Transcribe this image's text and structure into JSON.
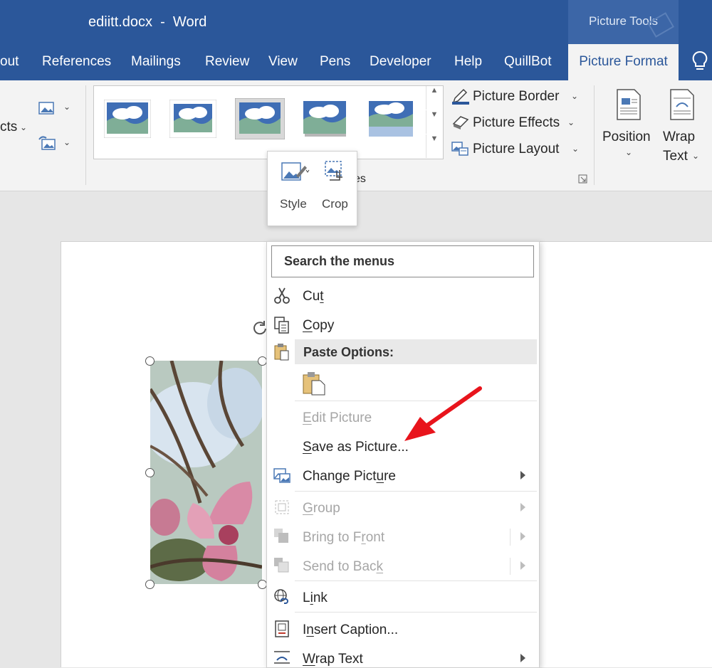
{
  "window": {
    "title": "ediitt.docx  -  Word",
    "context_group": "Picture Tools"
  },
  "tabs": [
    "out",
    "References",
    "Mailings",
    "Review",
    "View",
    "Pens",
    "Developer",
    "Help",
    "QuillBot"
  ],
  "active_tab": "Picture Format",
  "ribbon": {
    "left_partial_label": "cts",
    "picture_border": "Picture Border",
    "picture_effects": "Picture Effects",
    "picture_layout": "Picture Layout",
    "group_label_partial": "es",
    "position_label": "Position",
    "wrap_text_line1": "Wrap",
    "wrap_text_line2": "Text"
  },
  "mini_toolbar": {
    "style_label": "Style",
    "crop_label": "Crop"
  },
  "context_menu": {
    "search_placeholder": "Search the menus",
    "cut": {
      "pre": "Cu",
      "u": "t",
      "post": ""
    },
    "copy": {
      "pre": "",
      "u": "C",
      "post": "opy"
    },
    "paste_options": "Paste Options:",
    "edit_picture": {
      "pre": "",
      "u": "E",
      "post": "dit Picture"
    },
    "save_as_picture": {
      "pre": "",
      "u": "S",
      "post": "ave as Picture..."
    },
    "change_picture": {
      "pre": "Change Pict",
      "u": "u",
      "post": "re"
    },
    "group": {
      "pre": "",
      "u": "G",
      "post": "roup"
    },
    "bring_to_front": {
      "pre": "Bring to F",
      "u": "r",
      "post": "ont"
    },
    "send_to_back": {
      "pre": "Send to Bac",
      "u": "k",
      "post": ""
    },
    "link": {
      "pre": "L",
      "u": "i",
      "post": "nk"
    },
    "insert_caption": {
      "pre": "I",
      "u": "n",
      "post": "sert Caption..."
    },
    "wrap_text": {
      "pre": "",
      "u": "W",
      "post": "rap Text"
    }
  },
  "colors": {
    "word_blue": "#2b579a",
    "annotation_arrow": "#e8141c"
  }
}
